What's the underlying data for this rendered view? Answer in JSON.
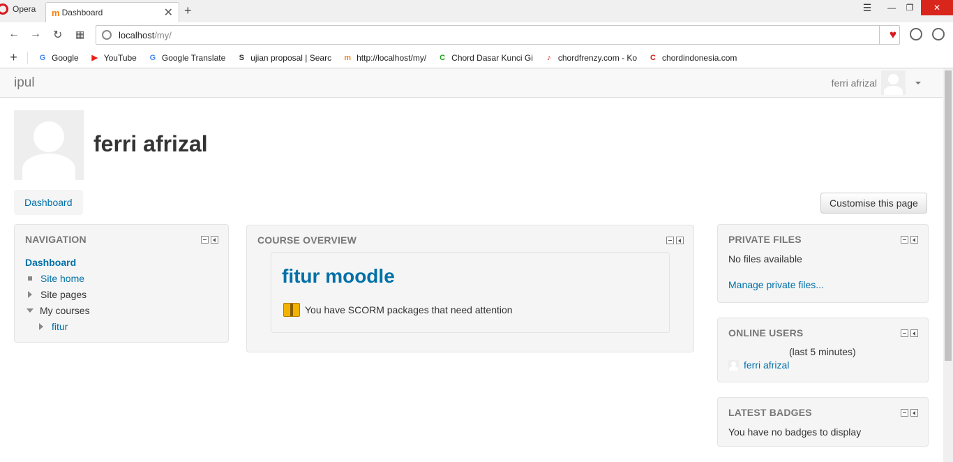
{
  "browser": {
    "name": "Opera",
    "tab_title": "Dashboard",
    "url_host": "localhost",
    "url_path": "/my/",
    "bookmarks": [
      {
        "label": "Google",
        "icon": "google-icon",
        "color": "#4285f4"
      },
      {
        "label": "YouTube",
        "icon": "youtube-icon",
        "color": "#e62117"
      },
      {
        "label": "Google Translate",
        "icon": "translate-icon",
        "color": "#4285f4"
      },
      {
        "label": "ujian proposal | Searc",
        "icon": "scribd-icon",
        "color": "#333333"
      },
      {
        "label": "http://localhost/my/",
        "icon": "moodle-icon",
        "color": "#f98012"
      },
      {
        "label": "Chord Dasar Kunci Gi",
        "icon": "chord-icon",
        "color": "#1aa31a"
      },
      {
        "label": "chordfrenzy.com - Ko",
        "icon": "guitar-icon",
        "color": "#d7191c"
      },
      {
        "label": "chordindonesia.com",
        "icon": "chordindonesia-icon",
        "color": "#d7191c"
      }
    ]
  },
  "site": {
    "brand": "ipul",
    "user_name": "ferri afrizal"
  },
  "header": {
    "fullname": "ferri afrizal",
    "breadcrumb": "Dashboard",
    "customise_label": "Customise this page"
  },
  "navigation": {
    "title": "NAVIGATION",
    "home": "Dashboard",
    "items": [
      {
        "label": "Site home",
        "type": "leaf"
      },
      {
        "label": "Site pages",
        "type": "collapsed"
      },
      {
        "label": "My courses",
        "type": "expanded"
      },
      {
        "label": "fitur",
        "type": "collapsed"
      }
    ]
  },
  "course_overview": {
    "title": "COURSE OVERVIEW",
    "course_name": "fitur moodle",
    "notice": "You have SCORM packages that need attention"
  },
  "private_files": {
    "title": "PRIVATE FILES",
    "empty_text": "No files available",
    "manage_link": "Manage private files..."
  },
  "online_users": {
    "title": "ONLINE USERS",
    "period": "(last 5 minutes)",
    "users": [
      "ferri afrizal"
    ]
  },
  "latest_badges": {
    "title": "LATEST BADGES",
    "empty_text": "You have no badges to display"
  },
  "colors": {
    "link": "#0070a8",
    "block_bg": "#f5f5f5",
    "opera_red": "#d7191c"
  }
}
